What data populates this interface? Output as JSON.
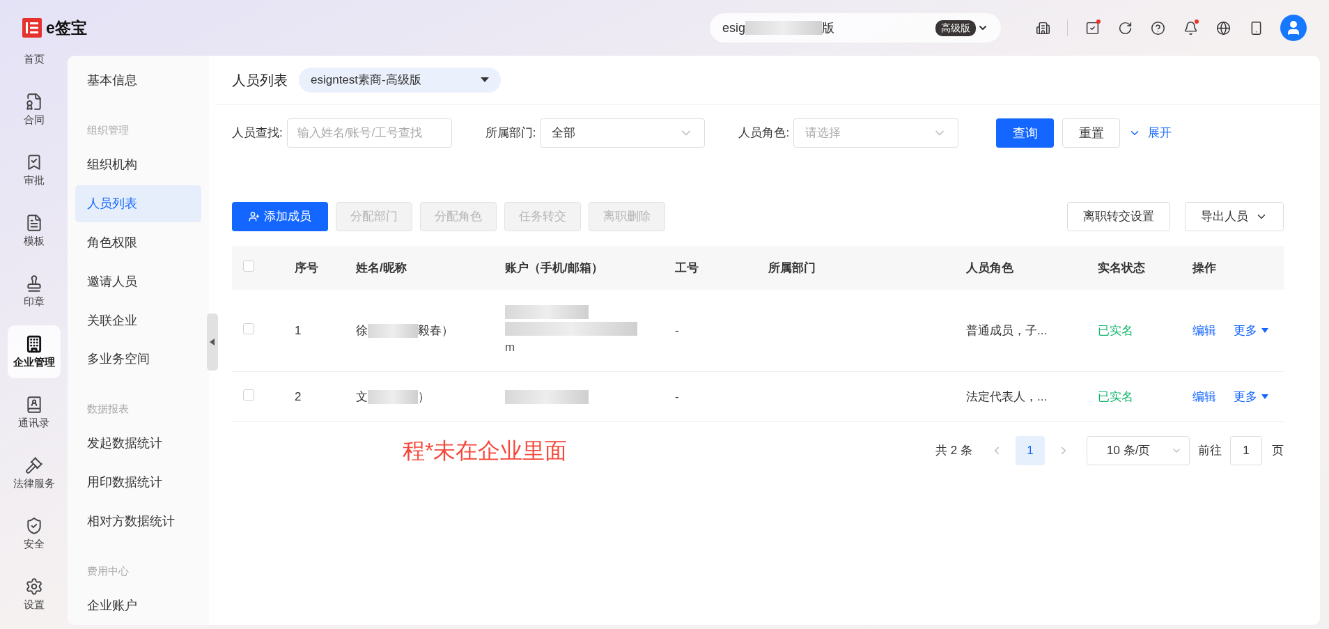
{
  "brand": {
    "name": "e签宝"
  },
  "org_switcher": {
    "text_start": "esig",
    "text_end": "版",
    "badge": "高级版"
  },
  "top_icons": [
    {
      "kind": "building",
      "dot": false
    },
    {
      "kind": "task",
      "dot": true
    },
    {
      "kind": "refresh",
      "dot": false
    },
    {
      "kind": "help",
      "dot": false
    },
    {
      "kind": "bell",
      "dot": true
    },
    {
      "kind": "globe",
      "dot": false
    },
    {
      "kind": "device",
      "dot": false
    }
  ],
  "rail": [
    {
      "label": "首页",
      "selected": false
    },
    {
      "label": "合同",
      "selected": false
    },
    {
      "label": "审批",
      "selected": false
    },
    {
      "label": "模板",
      "selected": false
    },
    {
      "label": "印章",
      "selected": false
    },
    {
      "label": "企业管理",
      "selected": true
    },
    {
      "label": "通讯录",
      "selected": false
    },
    {
      "label": "法律服务",
      "selected": false
    },
    {
      "label": "安全",
      "selected": false
    },
    {
      "label": "设置",
      "selected": false
    }
  ],
  "sidebar": [
    {
      "kind": "item",
      "label": "基本信息",
      "selected": false
    },
    {
      "kind": "group",
      "label": "组织管理"
    },
    {
      "kind": "item",
      "label": "组织机构",
      "selected": false
    },
    {
      "kind": "item",
      "label": "人员列表",
      "selected": true
    },
    {
      "kind": "item",
      "label": "角色权限",
      "selected": false
    },
    {
      "kind": "item",
      "label": "邀请人员",
      "selected": false
    },
    {
      "kind": "item",
      "label": "关联企业",
      "selected": false
    },
    {
      "kind": "item",
      "label": "多业务空间",
      "selected": false
    },
    {
      "kind": "group",
      "label": "数据报表"
    },
    {
      "kind": "item",
      "label": "发起数据统计",
      "selected": false
    },
    {
      "kind": "item",
      "label": "用印数据统计",
      "selected": false
    },
    {
      "kind": "item",
      "label": "相对方数据统计",
      "selected": false
    },
    {
      "kind": "group",
      "label": "费用中心"
    },
    {
      "kind": "item",
      "label": "企业账户",
      "selected": false
    }
  ],
  "page": {
    "title": "人员列表",
    "org_select": "esigntest素商-高级版"
  },
  "filters": [
    {
      "label": "人员查找:",
      "kind": "input",
      "placeholder": "输入姓名/账号/工号查找"
    },
    {
      "label": "所属部门:",
      "kind": "select",
      "value": "全部"
    },
    {
      "label": "人员角色:",
      "kind": "select",
      "placeholder": "请选择"
    }
  ],
  "filter_buttons": {
    "search": "查询",
    "reset": "重置",
    "expand": "展开"
  },
  "actions": [
    {
      "label": "添加成员",
      "kind": "primary",
      "disabled": false
    },
    {
      "label": "分配部门",
      "kind": "default",
      "disabled": true
    },
    {
      "label": "分配角色",
      "kind": "default",
      "disabled": true
    },
    {
      "label": "任务转交",
      "kind": "default",
      "disabled": true
    },
    {
      "label": "离职删除",
      "kind": "default",
      "disabled": true
    }
  ],
  "right_actions": [
    {
      "label": "离职转交设置",
      "dropdown": false
    },
    {
      "label": "导出人员",
      "dropdown": true
    }
  ],
  "table": {
    "all_checked": false,
    "columns": [
      "序号",
      "姓名/昵称",
      "账户（手机/邮箱）",
      "工号",
      "所属部门",
      "人员角色",
      "实名状态",
      "操作"
    ],
    "rows": [
      {
        "checked": false,
        "index": "1",
        "name_start": "徐",
        "name_end": "毅春）",
        "account_tail": "m",
        "job_no": "-",
        "role": "普通成员，子...",
        "status": "已实名",
        "edit": "编辑",
        "more": "更多"
      },
      {
        "checked": false,
        "index": "2",
        "name_start": "文",
        "name_end": "）",
        "job_no": "-",
        "role": "法定代表人，...",
        "status": "已实名",
        "edit": "编辑",
        "more": "更多"
      }
    ]
  },
  "note": "程*未在企业里面",
  "pagination": {
    "total": "共 2 条",
    "pages": [
      {
        "label": "1",
        "selected": true
      }
    ],
    "page_size": "10 条/页",
    "goto_label": "前往",
    "goto_value": "1",
    "page_suffix": "页"
  }
}
